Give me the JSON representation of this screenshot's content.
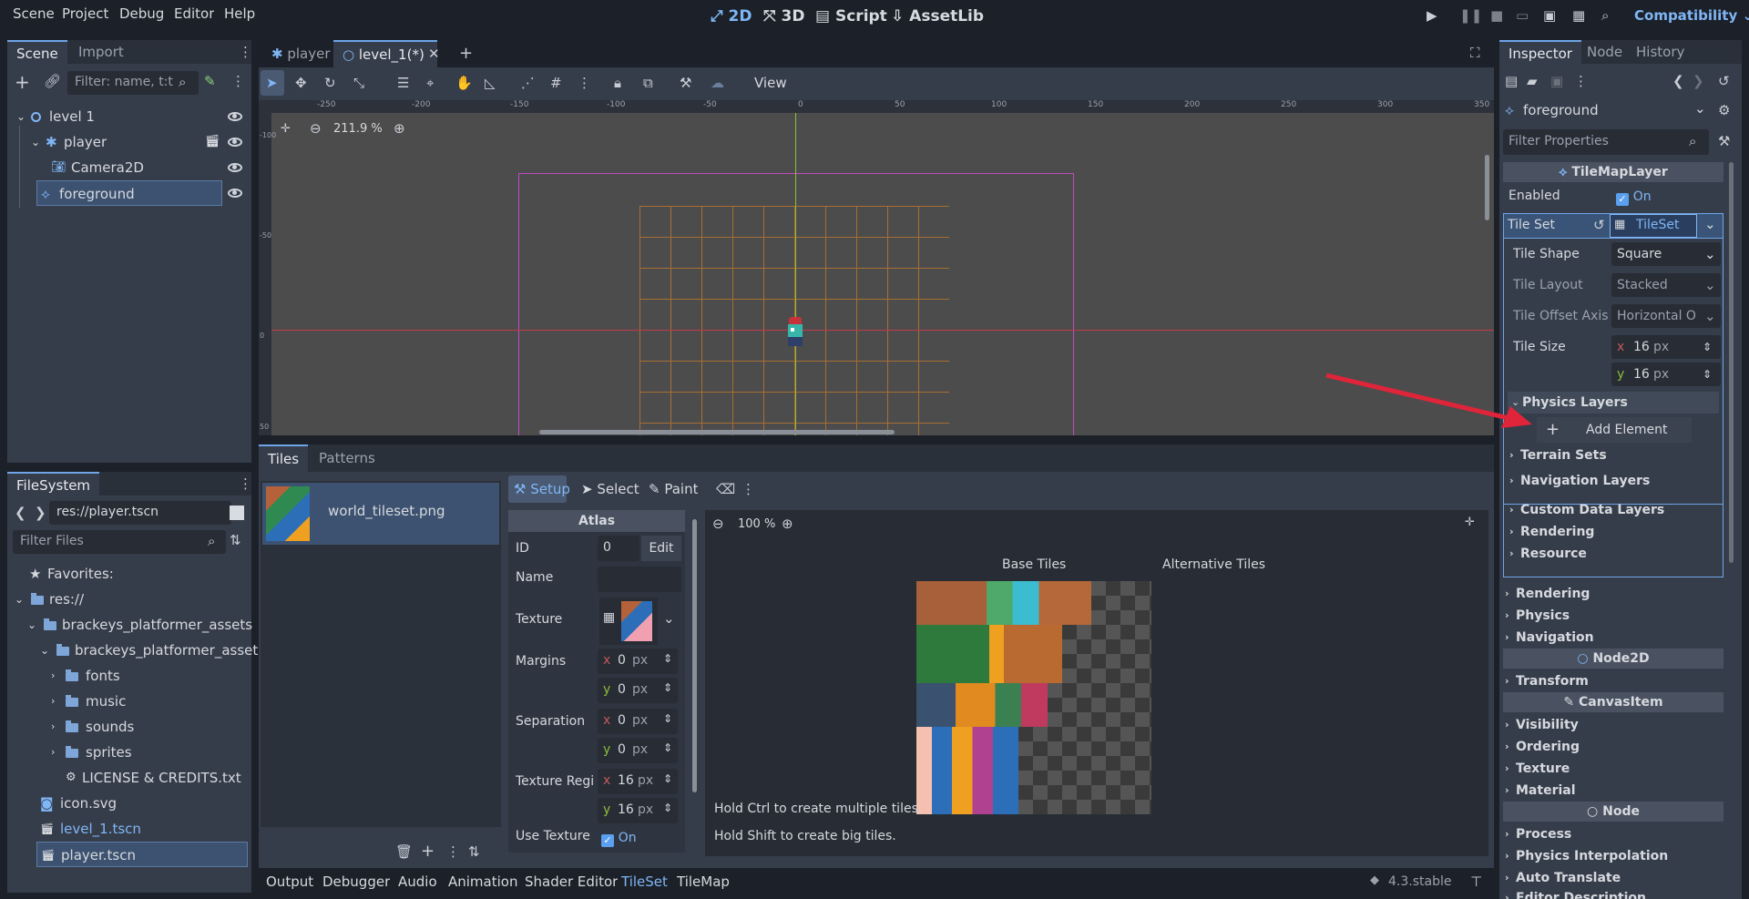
{
  "menu": {
    "items": [
      "Scene",
      "Project",
      "Debug",
      "Editor",
      "Help"
    ]
  },
  "workspaces": {
    "items": [
      "2D",
      "3D",
      "Script",
      "AssetLib"
    ],
    "active": "2D"
  },
  "renderer": "Compatibility",
  "scene_dock": {
    "tabs": [
      "Scene",
      "Import"
    ],
    "filter_placeholder": "Filter: name, t:t",
    "tree": [
      {
        "label": "level 1",
        "depth": 0
      },
      {
        "label": "player",
        "depth": 1
      },
      {
        "label": "Camera2D",
        "depth": 2
      },
      {
        "label": "foreground",
        "depth": 1,
        "selected": true
      }
    ]
  },
  "filesystem": {
    "tab": "FileSystem",
    "path": "res://player.tscn",
    "filter_placeholder": "Filter Files",
    "tree": [
      {
        "label": "Favorites:",
        "depth": 0
      },
      {
        "label": "res://",
        "depth": 0
      },
      {
        "label": "brackeys_platformer_assets",
        "depth": 1
      },
      {
        "label": "brackeys_platformer_assets",
        "depth": 2
      },
      {
        "label": "fonts",
        "depth": 3
      },
      {
        "label": "music",
        "depth": 3
      },
      {
        "label": "sounds",
        "depth": 3
      },
      {
        "label": "sprites",
        "depth": 3
      },
      {
        "label": "LICENSE & CREDITS.txt",
        "depth": 3
      },
      {
        "label": "icon.svg",
        "depth": 1
      },
      {
        "label": "level_1.tscn",
        "depth": 1
      },
      {
        "label": "player.tscn",
        "depth": 1,
        "selected": true
      }
    ]
  },
  "editor_tabs": {
    "items": [
      "player",
      "level_1(*)"
    ],
    "active": "level_1(*)"
  },
  "toolbar": {
    "view_label": "View"
  },
  "viewport": {
    "zoom": "211.9 %",
    "ruler_x": [
      "-250",
      "-200",
      "-150",
      "-100",
      "-50",
      "0",
      "50",
      "100",
      "150",
      "200",
      "250",
      "300",
      "350"
    ],
    "ruler_y": [
      "-100",
      "-50",
      "0",
      "50"
    ]
  },
  "bottom_panel": {
    "tabs": [
      "Tiles",
      "Patterns"
    ],
    "source_name": "world_tileset.png",
    "modes": [
      "Setup",
      "Select",
      "Paint"
    ],
    "atlas": {
      "header": "Atlas",
      "id_label": "ID",
      "id_value": "0",
      "edit_label": "Edit",
      "name_label": "Name",
      "texture_label": "Texture",
      "margins_label": "Margins",
      "margin_x": "0",
      "margin_y": "0",
      "separation_label": "Separation",
      "sep_x": "0",
      "sep_y": "0",
      "region_label": "Texture Regi",
      "region_x": "16",
      "region_y": "16",
      "use_texture_label": "Use Texture",
      "use_texture_value": "On",
      "unit": "px",
      "x": "x",
      "y": "y"
    },
    "atlas_zoom": "100 %",
    "base_tiles_label": "Base Tiles",
    "alt_tiles_label": "Alternative Tiles",
    "hint1": "Hold Ctrl to create multiple tiles.",
    "hint2": "Hold Shift to create big tiles."
  },
  "bottom_bar": {
    "items": [
      "Output",
      "Debugger",
      "Audio",
      "Animation",
      "Shader Editor",
      "TileSet",
      "TileMap"
    ],
    "active": "TileSet",
    "version": "4.3.stable"
  },
  "inspector": {
    "tabs": [
      "Inspector",
      "Node",
      "History"
    ],
    "node_name": "foreground",
    "filter_placeholder": "Filter Properties",
    "class_header": "TileMapLayer",
    "enabled_label": "Enabled",
    "enabled_value": "On",
    "tileset_label": "Tile Set",
    "tileset_value": "TileSet",
    "props": [
      {
        "label": "Tile Shape",
        "value": "Square"
      },
      {
        "label": "Tile Layout",
        "value": "Stacked"
      },
      {
        "label": "Tile Offset Axis",
        "value": "Horizontal O"
      }
    ],
    "tile_size_label": "Tile Size",
    "tile_size_x": "16",
    "tile_size_y": "16",
    "physics_layers": "Physics Layers",
    "add_element": "Add Element",
    "sub_sections": [
      "Terrain Sets",
      "Navigation Layers",
      "Custom Data Layers",
      "Rendering",
      "Resource"
    ],
    "sections_a": [
      "Rendering",
      "Physics",
      "Navigation"
    ],
    "node2d_header": "Node2D",
    "sections_b": [
      "Transform"
    ],
    "canvasitem_header": "CanvasItem",
    "sections_c": [
      "Visibility",
      "Ordering",
      "Texture",
      "Material"
    ],
    "node_header": "Node",
    "sections_d": [
      "Process",
      "Physics Interpolation",
      "Auto Translate",
      "Editor Description"
    ]
  },
  "colors": {
    "accent": "#6ea5e8",
    "annotation_arrow": "#e0243a"
  }
}
